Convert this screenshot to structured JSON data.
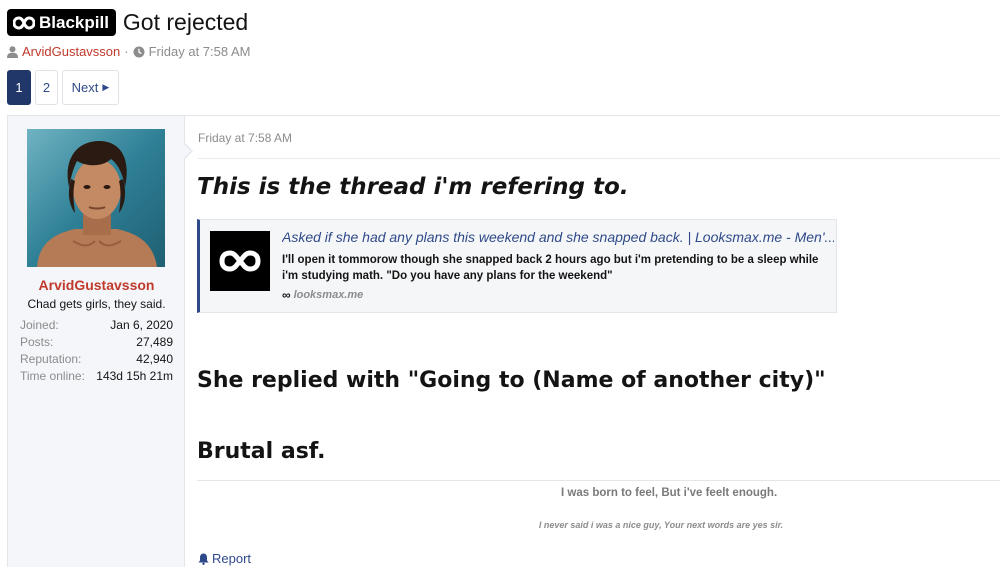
{
  "thread": {
    "prefix": "Blackpill",
    "title": "Got rejected",
    "author": "ArvidGustavsson",
    "separator": "·",
    "date": "Friday at 7:58 AM"
  },
  "pagination": {
    "pages": [
      "1",
      "2"
    ],
    "current": "1",
    "next_label": "Next"
  },
  "post": {
    "date": "Friday at 7:58 AM",
    "user": {
      "name": "ArvidGustavsson",
      "title": "Chad gets girls, they said.",
      "stats": [
        {
          "label": "Joined:",
          "value": "Jan 6, 2020"
        },
        {
          "label": "Posts:",
          "value": "27,489"
        },
        {
          "label": "Reputation:",
          "value": "42,940"
        },
        {
          "label": "Time online:",
          "value": "143d 15h 21m"
        }
      ]
    },
    "heading": "This is the thread i'm refering to.",
    "unfurl": {
      "title": "Asked if she had any plans this weekend and she snapped back. | Looksmax.me - Men'...",
      "description": "I'll open it tommorow though she snapped back 2 hours ago but i'm pretending to be a sleep while i'm studying math. \"Do you have any plans for the weekend\"",
      "domain": "looksmax.me",
      "icon": "infinity-icon"
    },
    "line1": "She replied with \"Going to (Name of another city)\"",
    "line2": "Brutal asf.",
    "signature": {
      "line1": "I was born to feel, But i've feelt enough.",
      "line2": "I never said i was a nice guy, Your next words are yes sir."
    },
    "report_label": "Report"
  },
  "colors": {
    "accent": "#213769",
    "link": "#2f4a8a",
    "username": "#c03a2b"
  }
}
